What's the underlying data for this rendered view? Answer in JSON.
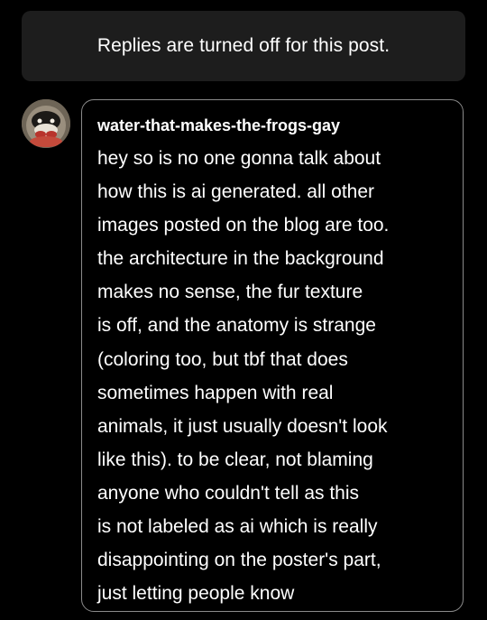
{
  "notice": {
    "text": "Replies are turned off for this post."
  },
  "reply": {
    "avatar_icon": "user-avatar",
    "username": "water-that-makes-the-frogs-gay",
    "lines": [
      "hey so is no one gonna talk about",
      "how this is ai generated. all other",
      "images posted on the blog are too.",
      "the architecture in the background",
      "makes no sense, the fur texture",
      "is off, and the anatomy is strange",
      "(coloring too, but tbf that does",
      "sometimes happen with real",
      "animals, it just usually doesn't look",
      "like this). to be clear, not blaming",
      "anyone who couldn't tell as this",
      "is not labeled as ai which is really",
      "disappointing on the poster's part,",
      "just letting people know"
    ]
  },
  "colors": {
    "background": "#000000",
    "notice_background": "#1d1d1d",
    "reply_border": "#8a8a8a",
    "text": "#ffffff"
  }
}
